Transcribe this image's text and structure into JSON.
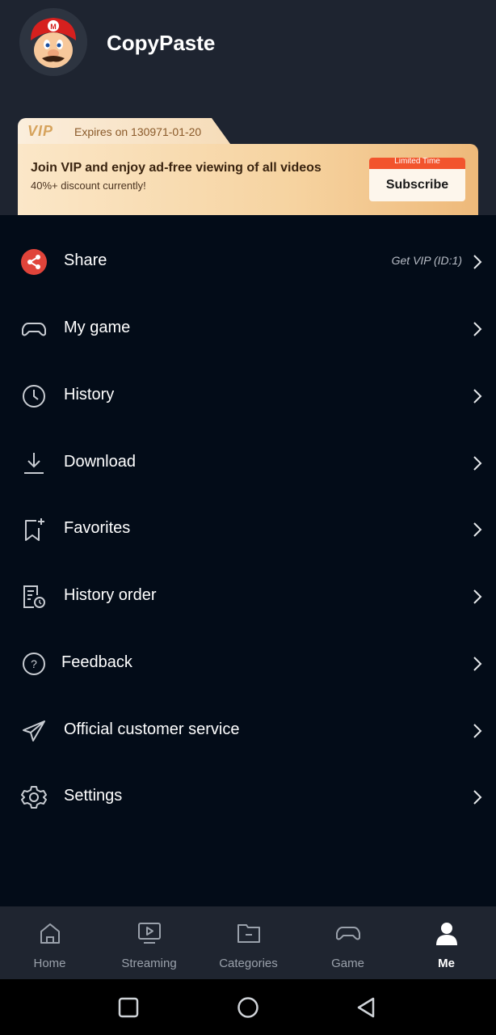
{
  "profile": {
    "username": "CopyPaste",
    "avatar_icon": "mario-avatar"
  },
  "vip": {
    "badge": "VIP",
    "expires": "Expires on 130971-01-20",
    "title": "Join VIP and enjoy ad-free viewing of all videos",
    "subtitle": "40%+ discount currently!",
    "button_tag": "Limited Time",
    "button_label": "Subscribe"
  },
  "menu": [
    {
      "label": "Share",
      "extra": "Get VIP (ID:1)",
      "icon": "share-icon"
    },
    {
      "label": "My game",
      "icon": "gamepad-icon"
    },
    {
      "label": "History",
      "icon": "clock-icon"
    },
    {
      "label": "Download",
      "icon": "download-icon"
    },
    {
      "label": "Favorites",
      "icon": "bookmark-add-icon"
    },
    {
      "label": "History order",
      "icon": "order-history-icon"
    },
    {
      "label": "Feedback",
      "icon": "question-icon"
    },
    {
      "label": "Official customer service",
      "icon": "paper-plane-icon"
    },
    {
      "label": "Settings",
      "icon": "gear-icon"
    }
  ],
  "nav": [
    {
      "label": "Home",
      "icon": "home-icon"
    },
    {
      "label": "Streaming",
      "icon": "tv-icon"
    },
    {
      "label": "Categories",
      "icon": "folder-icon"
    },
    {
      "label": "Game",
      "icon": "gamepad-icon"
    },
    {
      "label": "Me",
      "icon": "person-icon",
      "active": true
    }
  ],
  "colors": {
    "background": "#030c18",
    "header": "#1e2430",
    "accent": "#f2542d",
    "share": "#e0443a"
  }
}
